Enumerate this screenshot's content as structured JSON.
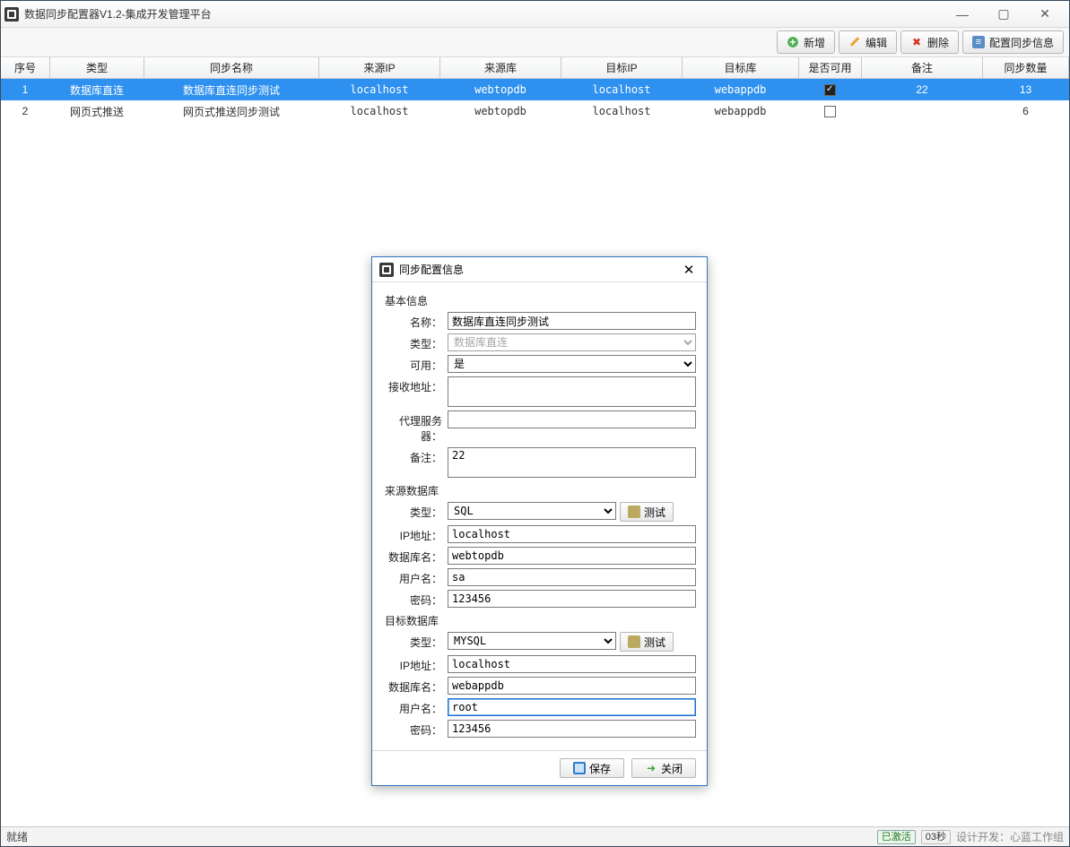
{
  "title": "数据同步配置器V1.2-集成开发管理平台",
  "window_controls": {
    "min": "—",
    "max": "▢",
    "close": "✕"
  },
  "toolbar": {
    "add": "新增",
    "edit": "编辑",
    "delete": "删除",
    "config": "配置同步信息"
  },
  "grid": {
    "headers": {
      "seq": "序号",
      "type": "类型",
      "name": "同步名称",
      "src_ip": "来源IP",
      "src_db": "来源库",
      "dst_ip": "目标IP",
      "dst_db": "目标库",
      "usable": "是否可用",
      "remark": "备注",
      "count": "同步数量"
    },
    "rows": [
      {
        "seq": "1",
        "type": "数据库直连",
        "name": "数据库直连同步测试",
        "src_ip": "localhost",
        "src_db": "webtopdb",
        "dst_ip": "localhost",
        "dst_db": "webappdb",
        "usable": true,
        "remark": "22",
        "count": "13"
      },
      {
        "seq": "2",
        "type": "网页式推送",
        "name": "网页式推送同步测试",
        "src_ip": "localhost",
        "src_db": "webtopdb",
        "dst_ip": "localhost",
        "dst_db": "webappdb",
        "usable": false,
        "remark": "",
        "count": "6"
      }
    ]
  },
  "dialog": {
    "title": "同步配置信息",
    "sections": {
      "basic": "基本信息",
      "src": "来源数据库",
      "dst": "目标数据库"
    },
    "labels": {
      "name": "名称：",
      "type": "类型：",
      "usable": "可用：",
      "recv": "接收地址：",
      "proxy": "代理服务器：",
      "remark": "备注：",
      "dbtype": "类型：",
      "ip": "IP地址：",
      "dbname": "数据库名：",
      "user": "用户名：",
      "pwd": "密码：",
      "test": "测试"
    },
    "values": {
      "name": "数据库直连同步测试",
      "type": "数据库直连",
      "usable": "是",
      "recv": "",
      "proxy": "",
      "remark": "22",
      "src": {
        "type": "SQL",
        "ip": "localhost",
        "db": "webtopdb",
        "user": "sa",
        "pwd": "123456"
      },
      "dst": {
        "type": "MYSQL",
        "ip": "localhost",
        "db": "webappdb",
        "user": "root",
        "pwd": "123456"
      }
    },
    "buttons": {
      "save": "保存",
      "close": "关闭"
    }
  },
  "status": {
    "left": "就绪",
    "active": "已激活",
    "timer": "03秒",
    "credits": "设计开发：心蓝工作组"
  }
}
